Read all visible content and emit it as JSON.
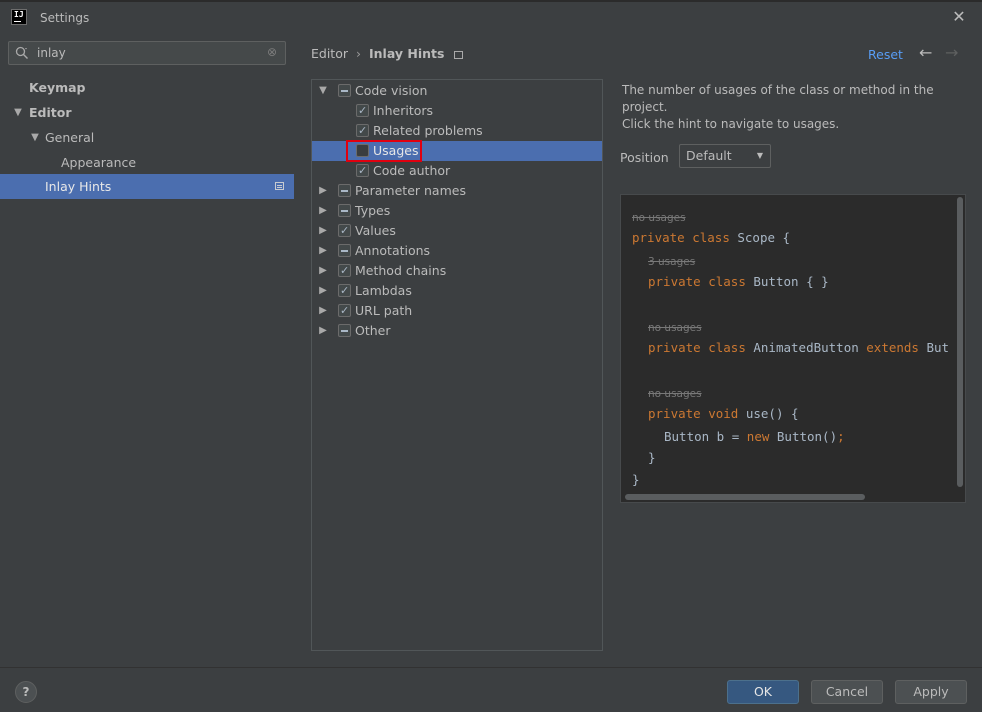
{
  "window": {
    "title": "Settings",
    "logo_text": "IJ"
  },
  "search": {
    "value": "inlay",
    "clear_glyph": "⊗"
  },
  "sidebar": {
    "items": [
      {
        "label": "Keymap"
      },
      {
        "label": "Editor"
      },
      {
        "label": "General"
      },
      {
        "label": "Appearance"
      },
      {
        "label": "Inlay Hints"
      }
    ]
  },
  "breadcrumb": {
    "parent": "Editor",
    "separator": "›",
    "current": "Inlay Hints"
  },
  "toolbar": {
    "reset_label": "Reset",
    "back_glyph": "←",
    "forward_glyph": "→"
  },
  "options": [
    {
      "label": "Code vision",
      "state": "partial",
      "expanded": true
    },
    {
      "label": "Inheritors",
      "state": "checked"
    },
    {
      "label": "Related problems",
      "state": "checked"
    },
    {
      "label": "Usages",
      "state": "unchecked",
      "selected": true
    },
    {
      "label": "Code author",
      "state": "checked"
    },
    {
      "label": "Parameter names",
      "state": "partial"
    },
    {
      "label": "Types",
      "state": "partial"
    },
    {
      "label": "Values",
      "state": "checked"
    },
    {
      "label": "Annotations",
      "state": "partial"
    },
    {
      "label": "Method chains",
      "state": "checked"
    },
    {
      "label": "Lambdas",
      "state": "checked"
    },
    {
      "label": "URL path",
      "state": "checked"
    },
    {
      "label": "Other",
      "state": "partial"
    }
  ],
  "description": {
    "line1": "The number of usages of the class or method in the project.",
    "line2": "Click the hint to navigate to usages."
  },
  "position": {
    "label": "Position",
    "value": "Default"
  },
  "preview": {
    "hint_no_usages": "no usages",
    "hint_3_usages": "3 usages",
    "kw_private": "private",
    "kw_class": "class",
    "kw_void": "void",
    "kw_extends": "extends",
    "kw_new": "new",
    "scope_name": " Scope {",
    "button_decl": " Button { }",
    "animated_decl": " AnimatedButton ",
    "animated_tail": " But",
    "use_decl": " use() {",
    "body_left": "Button b = ",
    "body_right": " Button()",
    "semicolon": ";",
    "close_inner": "}",
    "close_outer": "}"
  },
  "footer": {
    "help": "?",
    "ok": "OK",
    "cancel": "Cancel",
    "apply": "Apply"
  },
  "colors": {
    "selection": "#4b6eaf",
    "link": "#589df6",
    "keyword": "#cc7832",
    "highlight_box": "#e0000f"
  }
}
